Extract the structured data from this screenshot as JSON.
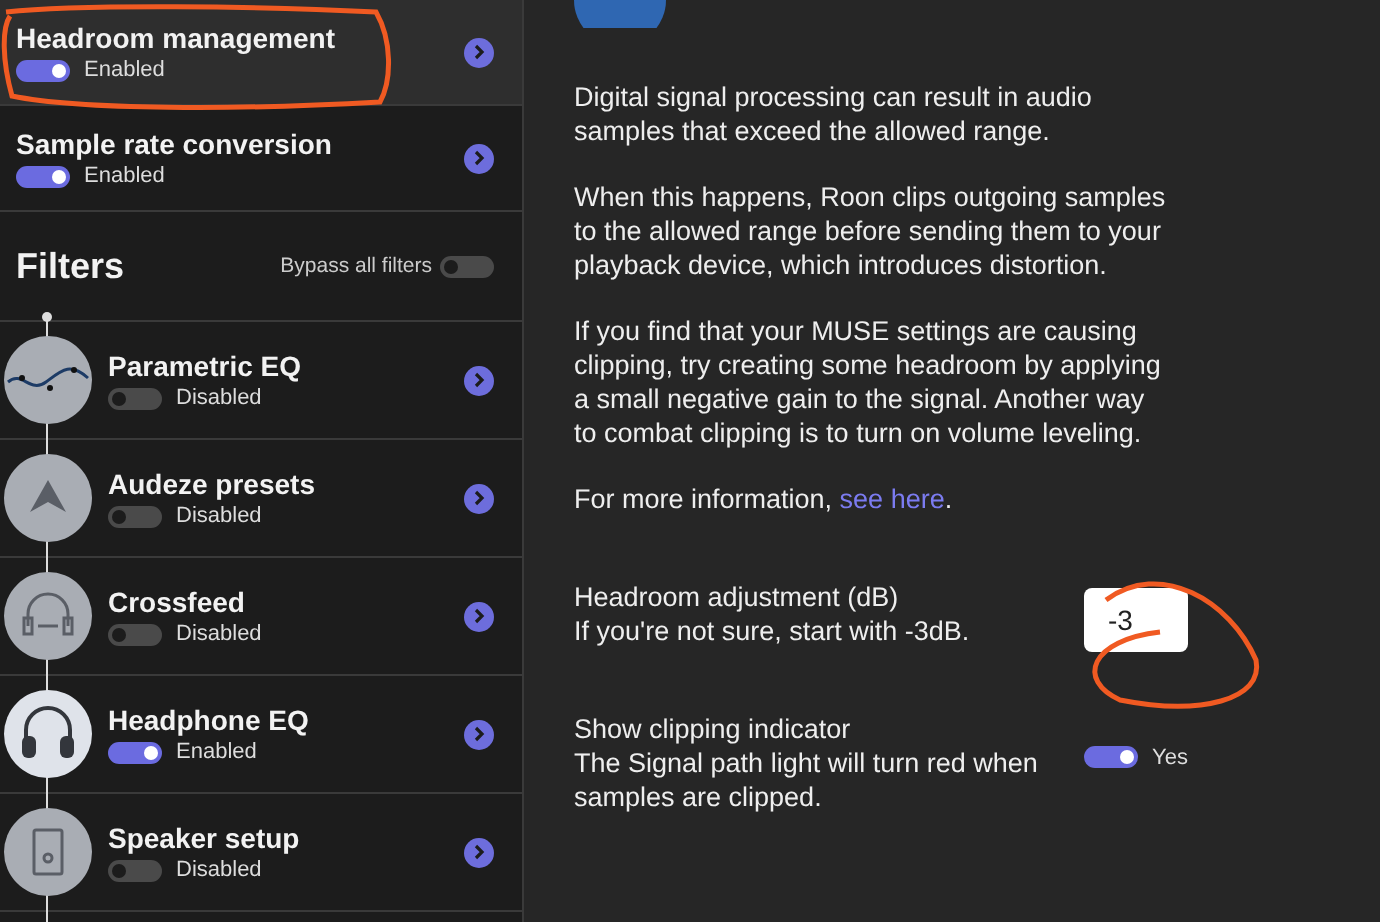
{
  "sidebar": {
    "items": [
      {
        "name": "Headroom management",
        "on": true,
        "status": "Enabled",
        "selected": true
      },
      {
        "name": "Sample rate conversion",
        "on": true,
        "status": "Enabled",
        "selected": false
      }
    ],
    "filters_header": {
      "title": "Filters",
      "bypass_label": "Bypass all filters",
      "bypass_on": false
    },
    "filters": [
      {
        "kind": "eq",
        "name": "Parametric EQ",
        "on": false,
        "status": "Disabled"
      },
      {
        "kind": "audeze",
        "name": "Audeze presets",
        "on": false,
        "status": "Disabled"
      },
      {
        "kind": "crossfeed",
        "name": "Crossfeed",
        "on": false,
        "status": "Disabled"
      },
      {
        "kind": "headphone",
        "name": "Headphone EQ",
        "on": true,
        "status": "Enabled"
      },
      {
        "kind": "speaker",
        "name": "Speaker setup",
        "on": false,
        "status": "Disabled"
      }
    ]
  },
  "detail": {
    "paragraphs": [
      "Digital signal processing can result in audio samples that exceed the allowed range.",
      "When this happens, Roon clips outgoing samples to the allowed range before sending them to your playback device, which introduces distortion.",
      "If you find that your MUSE settings are causing clipping, try creating some headroom by applying a small negative gain to the signal. Another way to combat clipping is to turn on volume leveling."
    ],
    "more_info": {
      "before": "For more information, ",
      "link": "see here",
      "after": "."
    },
    "headroom": {
      "label": "Headroom adjustment (dB)",
      "hint": "If you're not sure, start with -3dB.",
      "value": "-3"
    },
    "clipping": {
      "label": "Show clipping indicator",
      "hint": "The Signal path light will turn red when samples are clipped.",
      "on": true,
      "toggle_label": "Yes"
    }
  }
}
